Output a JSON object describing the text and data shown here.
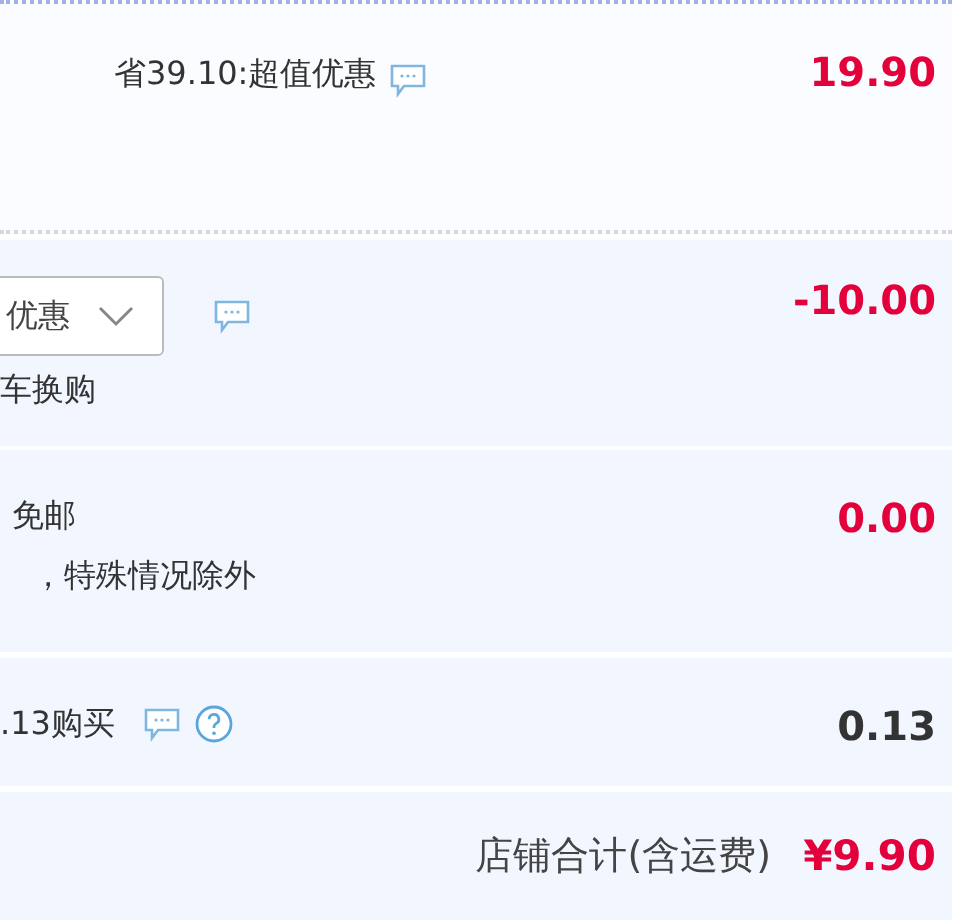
{
  "item": {
    "note": "省39.10:超值优惠",
    "price": "19.90",
    "price_highlighted": true
  },
  "promotion": {
    "dropdown": "优惠",
    "note": "车换购",
    "price": "-10.00",
    "price_highlighted": true
  },
  "shipping": {
    "label": "免邮",
    "note": "，特殊情况除外",
    "price": "0.00",
    "price_highlighted": true
  },
  "points": {
    "label": ".13购买",
    "price": "0.13",
    "price_highlighted": false
  },
  "total": {
    "label": "店铺合计(含运费)",
    "price": "¥9.90"
  }
}
